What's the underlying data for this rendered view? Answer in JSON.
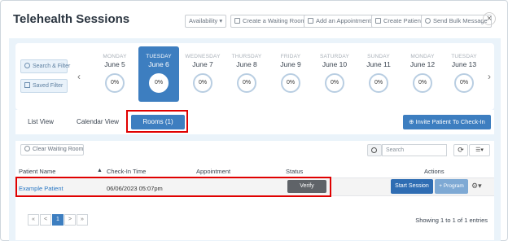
{
  "header": {
    "title": "Telehealth Sessions",
    "buttons": {
      "availability": "Availability",
      "create_waiting_room": "Create a Waiting Room",
      "add_appointment": "Add an Appointment",
      "create_patient": "Create Patient",
      "send_bulk_message": "Send Bulk Message"
    },
    "close_glyph": "×"
  },
  "filters": {
    "search_filter": "Search & Filter",
    "saved_filter": "Saved Filter"
  },
  "days": [
    {
      "name": "MONDAY",
      "date": "June 5",
      "pct": "0%"
    },
    {
      "name": "TUESDAY",
      "date": "June 6",
      "pct": "0%"
    },
    {
      "name": "WEDNESDAY",
      "date": "June 7",
      "pct": "0%"
    },
    {
      "name": "THURSDAY",
      "date": "June 8",
      "pct": "0%"
    },
    {
      "name": "FRIDAY",
      "date": "June 9",
      "pct": "0%"
    },
    {
      "name": "SATURDAY",
      "date": "June 10",
      "pct": "0%"
    },
    {
      "name": "SUNDAY",
      "date": "June 11",
      "pct": "0%"
    },
    {
      "name": "MONDAY",
      "date": "June 12",
      "pct": "0%"
    },
    {
      "name": "TUESDAY",
      "date": "June 13",
      "pct": "0%"
    }
  ],
  "nav": {
    "prev": "‹",
    "next": "›"
  },
  "tabs": {
    "list_view": "List View",
    "calendar_view": "Calendar View",
    "rooms": "Rooms (1)",
    "invite": "Invite Patient To Check-In"
  },
  "table": {
    "clear_waiting_room": "Clear Waiting Room",
    "search_placeholder": "Search",
    "headers": {
      "patient_name": "Patient Name",
      "check_in_time": "Check-In Time",
      "appointment": "Appointment",
      "status": "Status",
      "actions": "Actions"
    },
    "sort_glyph": "▲",
    "row": {
      "patient": "Example Patient",
      "check_in": "06/06/2023 05:07pm",
      "appointment": "",
      "verify": "Verify",
      "start_session": "Start Session",
      "program": "+ Program"
    }
  },
  "pagination": {
    "first": "«",
    "prev": "<",
    "page": "1",
    "next": ">",
    "last": "»",
    "showing": "Showing 1 to 1 of 1 entries"
  },
  "colors": {
    "accent": "#3d7ec0",
    "highlight_box": "#e00000"
  }
}
